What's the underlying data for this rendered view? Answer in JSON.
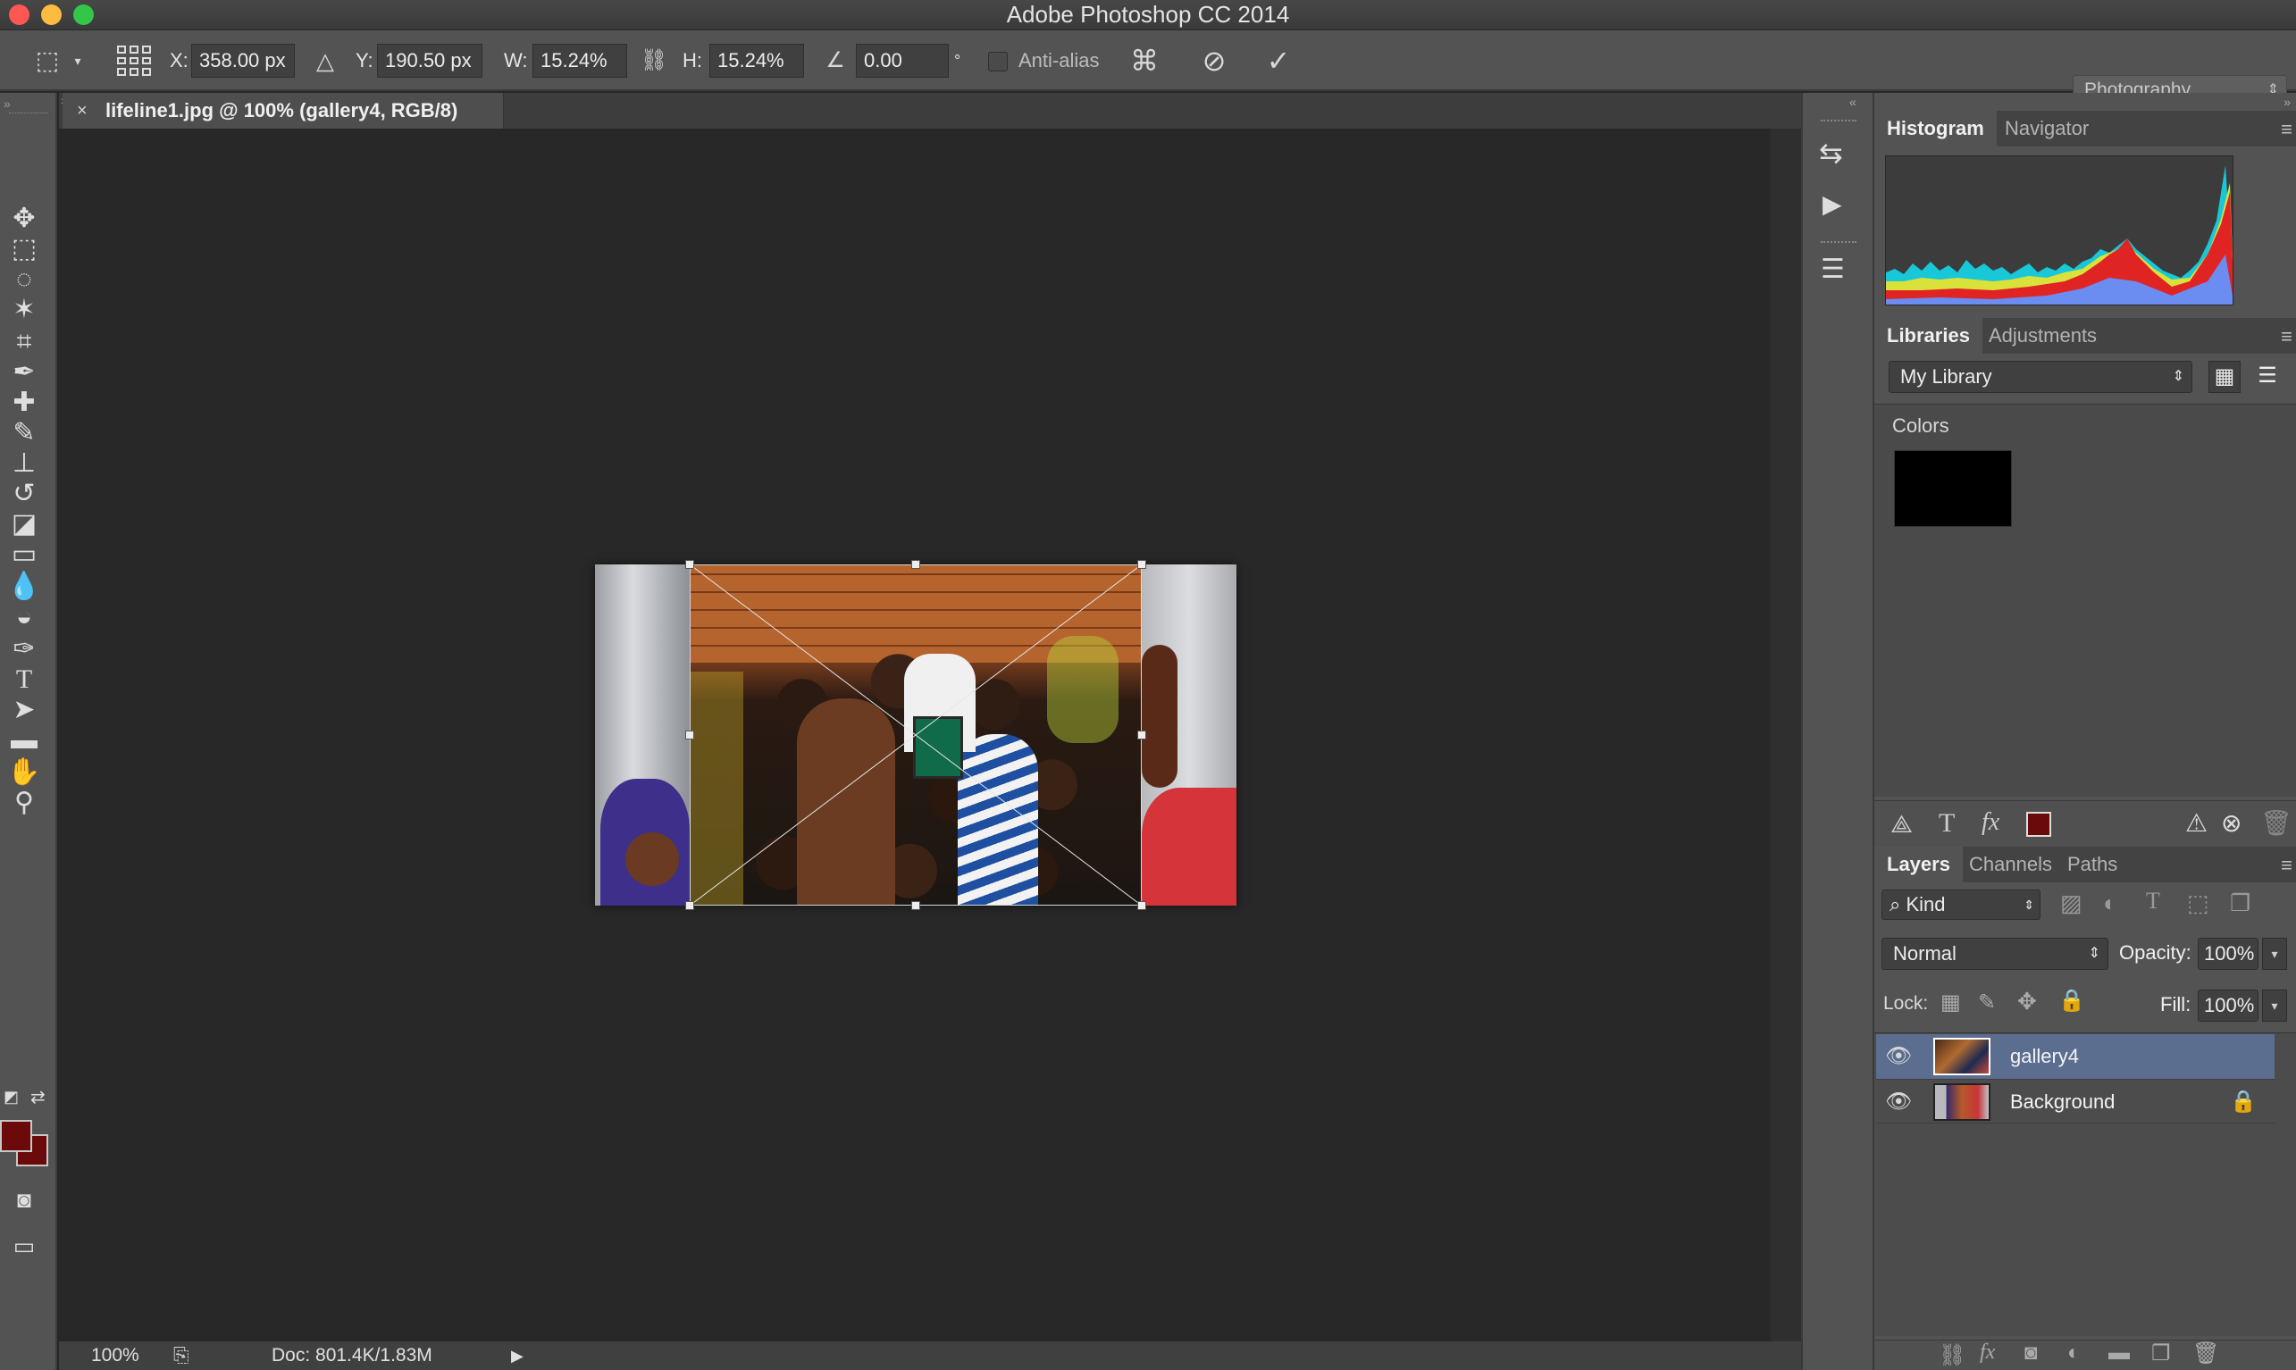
{
  "window": {
    "title": "Adobe Photoshop CC 2014"
  },
  "colors": {
    "foreground": "#6b0a0a",
    "background": "#6b0a0a",
    "selection": "#5b6e8f"
  },
  "options": {
    "x_label": "X:",
    "x_value": "358.00 px",
    "y_label": "Y:",
    "y_value": "190.50 px",
    "w_label": "W:",
    "w_value": "15.24%",
    "h_label": "H:",
    "h_value": "15.24%",
    "angle_value": "0.00",
    "degree_symbol": "°",
    "antialias_label": "Anti-alias",
    "workspace": "Photography"
  },
  "document": {
    "tab_title": "lifeline1.jpg @ 100% (gallery4, RGB/8)",
    "close": "×"
  },
  "status": {
    "zoom": "100%",
    "doc": "Doc: 801.4K/1.83M"
  },
  "histogram_panel": {
    "tabs": [
      "Histogram",
      "Navigator"
    ]
  },
  "libraries_panel": {
    "tabs": [
      "Libraries",
      "Adjustments"
    ],
    "library": "My Library",
    "section": "Colors",
    "swatch": "#000000"
  },
  "layers_panel": {
    "tabs": [
      "Layers",
      "Channels",
      "Paths"
    ],
    "filter": "Kind",
    "blend_mode": "Normal",
    "opacity_label": "Opacity:",
    "opacity_value": "100%",
    "lock_label": "Lock:",
    "fill_label": "Fill:",
    "fill_value": "100%",
    "layers": [
      {
        "name": "gallery4",
        "selected": true
      },
      {
        "name": "Background",
        "locked": true
      }
    ]
  },
  "tools": [
    "move-icon",
    "marquee-icon",
    "lasso-icon",
    "magic-wand-icon",
    "crop-icon",
    "eyedropper-icon",
    "healing-brush-icon",
    "brush-icon",
    "clone-stamp-icon",
    "history-brush-icon",
    "eraser-icon",
    "gradient-icon",
    "blur-icon",
    "dodge-icon",
    "pen-icon",
    "type-icon",
    "path-select-icon",
    "rectangle-icon",
    "hand-icon",
    "zoom-icon"
  ]
}
